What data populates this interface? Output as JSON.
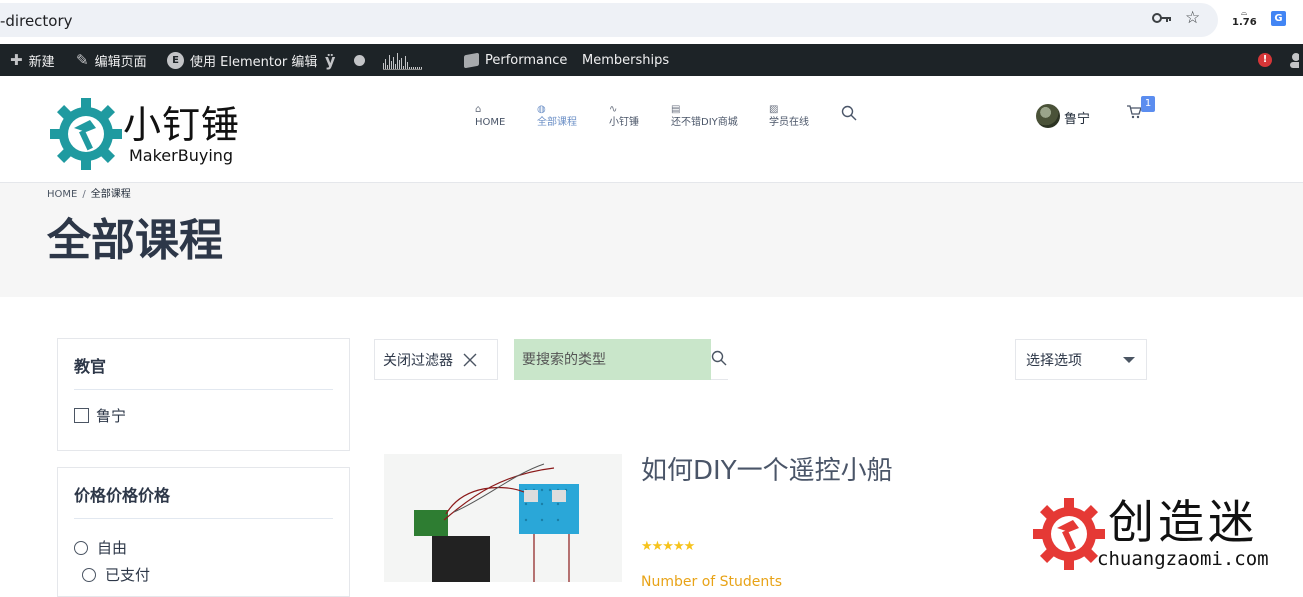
{
  "browser": {
    "url_fragment": "-directory",
    "extension_badge": "1.76"
  },
  "admin_bar": {
    "new_label": "新建",
    "edit_page_label": "编辑页面",
    "elementor_label": "使用 Elementor 编辑",
    "performance_label": "Performance",
    "memberships_label": "Memberships",
    "alert_symbol": "!"
  },
  "header": {
    "logo_title": "小钉锤",
    "logo_subtitle": "MakerBuying",
    "nav": [
      {
        "label": "HOME",
        "icon": "home-icon"
      },
      {
        "label": "全部课程",
        "icon": "globe-icon"
      },
      {
        "label": "小钉锤",
        "icon": "pulse-icon"
      },
      {
        "label": "还不错DIY商城",
        "icon": "store-icon"
      },
      {
        "label": "学员在线",
        "icon": "image-icon"
      }
    ],
    "user_name": "鲁宁",
    "cart_count": "1",
    "accent_color": "#5b8def"
  },
  "breadcrumb": {
    "home": "HOME",
    "separator": "/",
    "current": "全部课程"
  },
  "page_title": "全部课程",
  "filters": {
    "instructor": {
      "title": "教官",
      "options": [
        "鲁宁"
      ]
    },
    "price": {
      "title": "价格价格价格",
      "options": [
        "自由",
        "已支付"
      ]
    },
    "close_label": "关闭过滤器",
    "search_placeholder": "要搜索的类型",
    "sort_placeholder": "选择选项"
  },
  "course": {
    "title": "如何DIY一个遥控小船",
    "stars": "★★★★★",
    "meta_label": "Number of Students"
  },
  "watermark": {
    "title": "创造迷",
    "subtitle": "chuangzaomi.com",
    "color": "#e53935"
  }
}
